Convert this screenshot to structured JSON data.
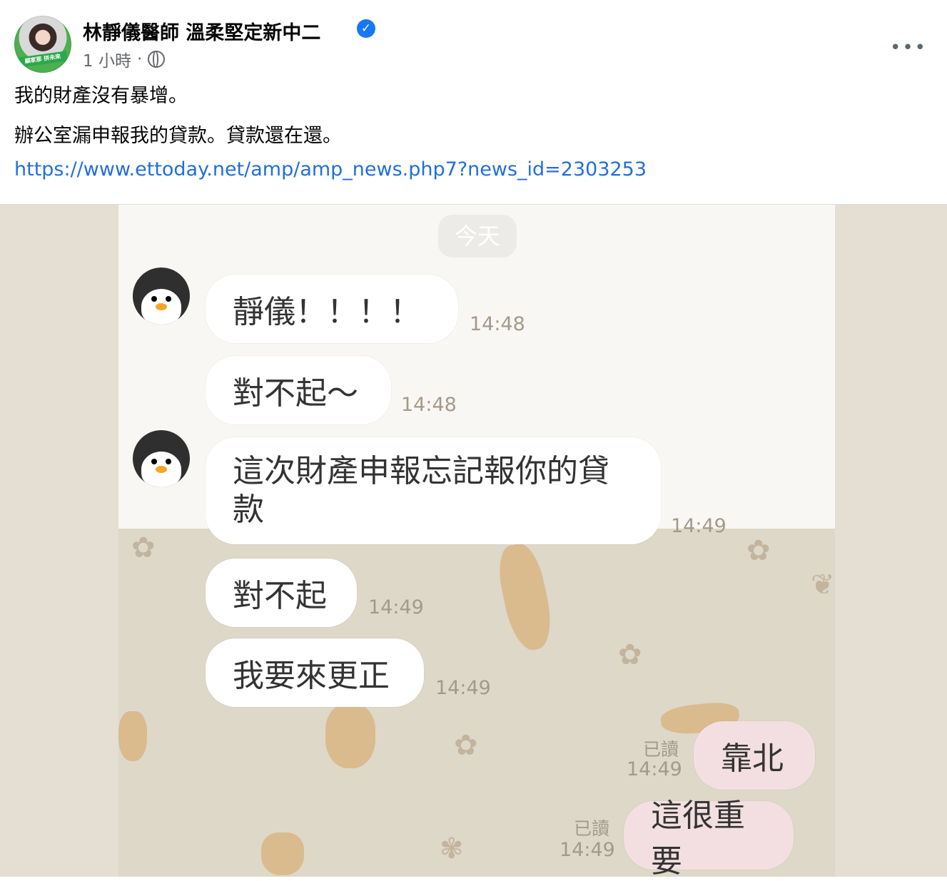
{
  "post": {
    "author": "林靜儀醫師 溫柔堅定新中二",
    "verified_icon": "verified-check-icon",
    "time": "1 小時",
    "separator": "·",
    "audience_icon": "globe-icon",
    "more_label": "•••",
    "avatar_badge": "顧家那 拼未來",
    "text_line1": "我的財產沒有暴增。",
    "text_line2": "辦公室漏申報我的貸款。貸款還在還。",
    "link": "https://www.ettoday.net/amp/amp_news.php7?news_id=2303253"
  },
  "chat": {
    "date_chip": "今天",
    "messages": [
      {
        "text": "靜儀！！！！",
        "time": "14:48"
      },
      {
        "text": "對不起～",
        "time": "14:48"
      },
      {
        "text_line1": "這次財產申報忘記報你的貸",
        "text_line2": "款",
        "time": "14:49"
      },
      {
        "text": "對不起",
        "time": "14:49"
      },
      {
        "text": "我要來更正",
        "time": "14:49"
      }
    ],
    "replies": [
      {
        "text": "靠北",
        "read": "已讀",
        "time": "14:49"
      },
      {
        "text": "這很重要",
        "read": "已讀",
        "time": "14:49"
      }
    ]
  },
  "colors": {
    "link": "#216fdb",
    "verified": "#1877f2",
    "reply_bubble": "#f3dfe1",
    "chat_bg": "#ded8c9"
  }
}
